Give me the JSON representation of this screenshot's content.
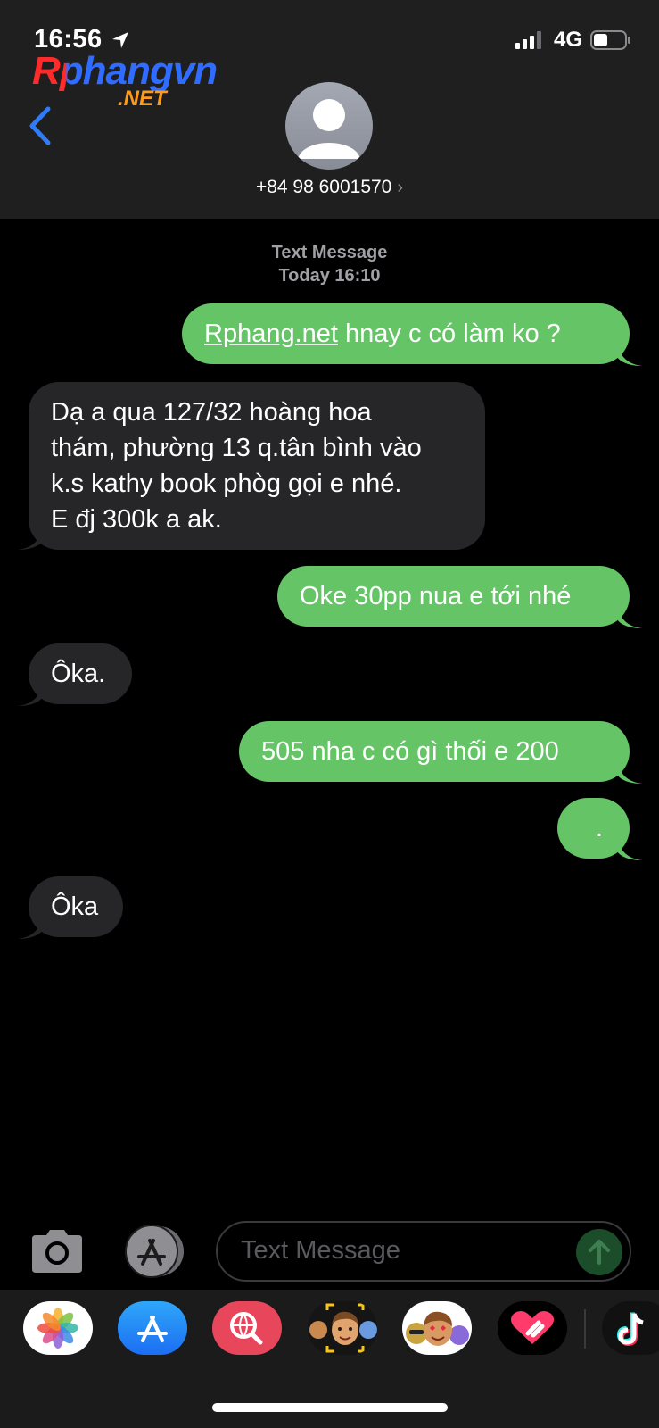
{
  "status_bar": {
    "time": "16:56",
    "network": "4G"
  },
  "watermark": {
    "main": "Rphangvn",
    "suffix": ".NET"
  },
  "header": {
    "contact": "+84 98 6001570",
    "chevron": "›"
  },
  "thread": {
    "type_label": "Text Message",
    "timestamp": "Today 16:10"
  },
  "messages": [
    {
      "dir": "out",
      "link": "Rphang.net",
      "text": " hnay c có làm ko ?"
    },
    {
      "dir": "in",
      "lines": [
        "Dạ a qua 127/32 hoàng hoa",
        "thám, phường 13 q.tân bình vào",
        "k.s kathy book phòg gọi e nhé.",
        "E đj 300k a ak."
      ]
    },
    {
      "dir": "out",
      "text": "Oke 30pp nua e tới nhé"
    },
    {
      "dir": "in",
      "text": "Ôka."
    },
    {
      "dir": "out",
      "text": "505 nha c có gì thối e 200"
    },
    {
      "dir": "out",
      "text": "."
    },
    {
      "dir": "in",
      "text": "Ôka"
    }
  ],
  "input": {
    "placeholder": "Text Message"
  },
  "icons": [
    "location-arrow-icon",
    "signal-icon",
    "battery-icon",
    "back-chevron-icon",
    "avatar-icon",
    "camera-icon",
    "app-store-icon",
    "send-arrow-icon",
    "photos-app-icon",
    "app-store-app-icon",
    "web-search-app-icon",
    "memoji-app-icon",
    "animoji-app-icon",
    "digital-touch-app-icon",
    "tiktok-app-icon"
  ],
  "colors": {
    "outgoing": "#65c466",
    "incoming": "#262628",
    "accent": "#2f7cf6"
  }
}
